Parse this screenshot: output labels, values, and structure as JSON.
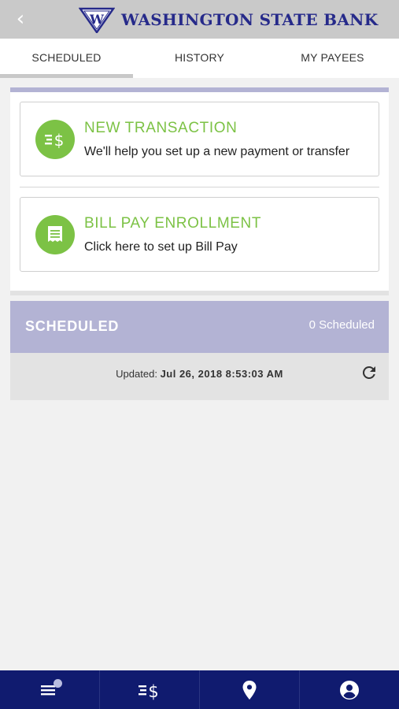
{
  "header": {
    "back_icon": "chevron-left-icon",
    "logo_letter": "W",
    "bank_name": "WASHINGTON STATE BANK"
  },
  "tabs": [
    {
      "label": "SCHEDULED",
      "active": true
    },
    {
      "label": "HISTORY",
      "active": false
    },
    {
      "label": "MY PAYEES",
      "active": false
    }
  ],
  "actions": [
    {
      "title": "NEW TRANSACTION",
      "subtitle": "We'll help you set up a new payment or transfer",
      "icon": "transfer-dollar-icon"
    },
    {
      "title": "BILL PAY ENROLLMENT",
      "subtitle": "Click here to set up Bill Pay",
      "icon": "receipt-icon"
    }
  ],
  "scheduled": {
    "title": "SCHEDULED",
    "count": "0 Scheduled",
    "updated_label": "Updated:",
    "updated_value": "Jul 26, 2018 8:53:03 AM",
    "refresh_icon": "refresh-icon"
  },
  "bottom_nav": [
    {
      "icon": "menu-icon"
    },
    {
      "icon": "transfer-dollar-icon"
    },
    {
      "icon": "location-pin-icon"
    },
    {
      "icon": "profile-icon"
    }
  ],
  "colors": {
    "header_bg": "#c9c9c9",
    "brand_navy": "#262a8a",
    "accent_green": "#7cc245",
    "section_lavender": "#b3b3d4",
    "nav_bg": "#101b6f"
  }
}
